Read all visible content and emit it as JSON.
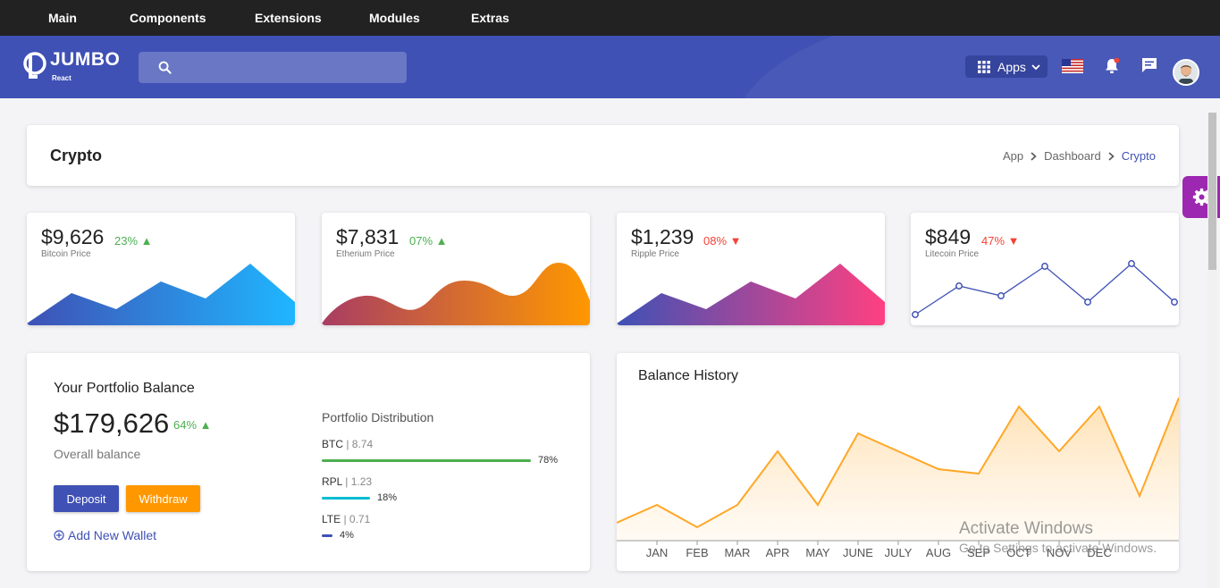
{
  "topnav": {
    "items": [
      "Main",
      "Components",
      "Extensions",
      "Modules",
      "Extras"
    ]
  },
  "header": {
    "logo": {
      "name": "JUMBO",
      "sub": "React"
    },
    "apps_label": "Apps"
  },
  "page": {
    "title": "Crypto",
    "breadcrumb": [
      "App",
      "Dashboard",
      "Crypto"
    ]
  },
  "stats": [
    {
      "amount": "$9,626",
      "pct": "23%",
      "trend": "up",
      "label": "Bitcoin Price"
    },
    {
      "amount": "$7,831",
      "pct": "07%",
      "trend": "up",
      "label": "Etherium Price"
    },
    {
      "amount": "$1,239",
      "pct": "08%",
      "trend": "down",
      "label": "Ripple Price"
    },
    {
      "amount": "$849",
      "pct": "47%",
      "trend": "down",
      "label": "Litecoin Price"
    }
  ],
  "portfolio": {
    "title": "Your Portfolio Balance",
    "balance": "$179,626",
    "balance_pct": "64%",
    "overall_label": "Overall balance",
    "deposit_label": "Deposit",
    "withdraw_label": "Withdraw",
    "add_wallet_label": "Add New Wallet",
    "distribution_title": "Portfolio Distribution",
    "coins": [
      {
        "name": "BTC",
        "value": "8.74",
        "pct": "78%",
        "fraction": 0.78,
        "color": "#4caf50"
      },
      {
        "name": "RPL",
        "value": "1.23",
        "pct": "18%",
        "fraction": 0.18,
        "color": "#00bcd4"
      },
      {
        "name": "LTE",
        "value": "0.71",
        "pct": "4%",
        "fraction": 0.04,
        "color": "#3f51b5"
      }
    ]
  },
  "history": {
    "title": "Balance History",
    "months": [
      "JAN",
      "FEB",
      "MAR",
      "APR",
      "MAY",
      "JUNE",
      "JULY",
      "AUG",
      "SEP",
      "OCT",
      "NOV",
      "DEC"
    ]
  },
  "watermark": {
    "line1": "Activate Windows",
    "line2": "Go to Settings to activate Windows."
  },
  "colors": {
    "primary": "#3f51b5",
    "accent": "#ff9800",
    "topbar": "#222222",
    "settings": "#9c27b0"
  }
}
